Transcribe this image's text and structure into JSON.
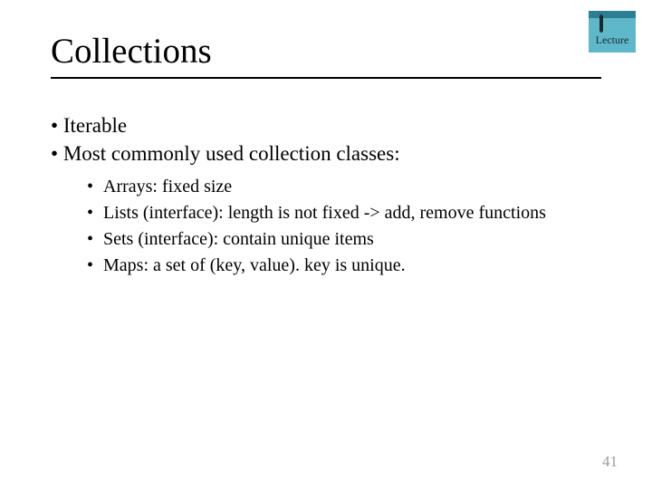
{
  "slide": {
    "title": "Collections",
    "bullets": [
      "Iterable",
      "Most commonly used collection classes:"
    ],
    "sub_bullets": [
      "Arrays: fixed size",
      "Lists (interface): length is not fixed -> add, remove functions",
      "Sets (interface): contain unique items",
      "Maps: a set of (key, value). key is unique."
    ],
    "page_number": "41",
    "logo_label": "Lecture"
  }
}
